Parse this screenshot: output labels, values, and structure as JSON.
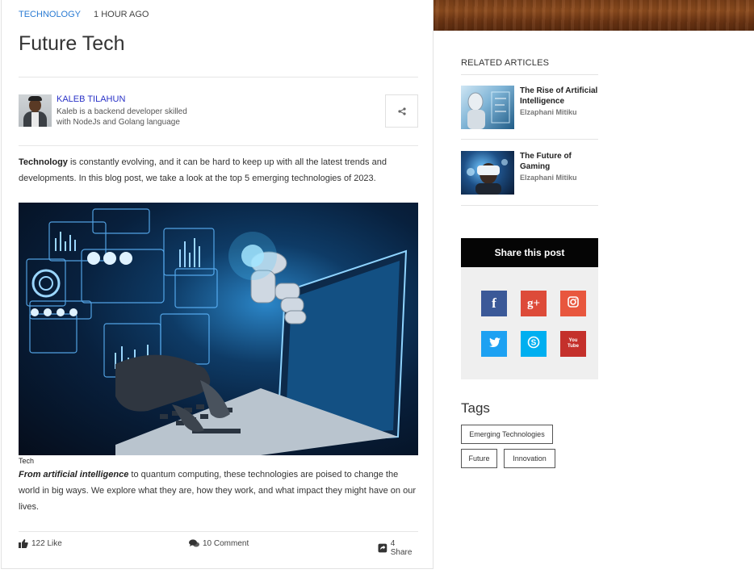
{
  "article": {
    "category": "TECHNOLOGY",
    "time_ago": "1 HOUR AGO",
    "title": "Future Tech",
    "author": {
      "name": "KALEB TILAHUN",
      "bio": "Kaleb is a backend developer skilled with NodeJs and Golang language"
    },
    "share_icon": "share-icon",
    "intro_bold": "Technology",
    "intro_rest": " is constantly evolving, and it can be hard to keep up with all the latest trends and developments. In this blog post, we take a look at the top 5 emerging technologies of 2023.",
    "image_caption": "Tech",
    "body_lead": "From artificial intelligence",
    "body_rest": " to quantum computing, these technologies are poised to change the world in big ways. We explore what they are, how they work, and what impact they might have on our lives.",
    "actions": {
      "like": "122 Like",
      "comment": "10 Comment",
      "share": "4 Share"
    }
  },
  "sidebar": {
    "related_heading": "RELATED ARTICLES",
    "related": [
      {
        "title": "The Rise of Artificial Intelligence",
        "author": "Elzaphani Mitiku"
      },
      {
        "title": "The Future of Gaming",
        "author": "Elzaphani Mitiku"
      }
    ],
    "share_heading": "Share this post",
    "share_buttons": [
      {
        "name": "facebook-icon",
        "glyph": "f",
        "color": "#3b5998"
      },
      {
        "name": "google-plus-icon",
        "glyph": "g+",
        "color": "#dd4b39"
      },
      {
        "name": "instagram-icon",
        "glyph": "",
        "color": "#e8573e"
      },
      {
        "name": "twitter-icon",
        "glyph": "",
        "color": "#1da1f2"
      },
      {
        "name": "skype-icon",
        "glyph": "S",
        "color": "#00aff0"
      },
      {
        "name": "youtube-icon",
        "glyph": "You Tube",
        "color": "#c4302b"
      }
    ],
    "tags_heading": "Tags",
    "tags": [
      "Emerging Technologies",
      "Future",
      "Innovation"
    ]
  },
  "colors": {
    "accent_link": "#2a7bd3",
    "author_link": "#2a32c7"
  }
}
